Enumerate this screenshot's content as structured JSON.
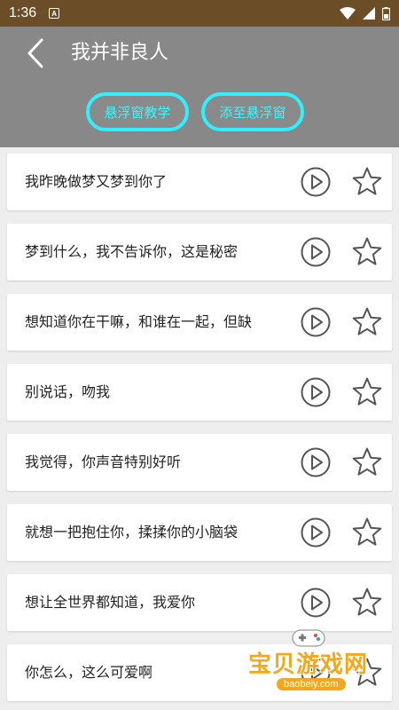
{
  "status_bar": {
    "time": "1:36",
    "notification_letter": "A"
  },
  "header": {
    "title": "我并非良人",
    "buttons": [
      "悬浮窗教学",
      "添至悬浮窗"
    ]
  },
  "colors": {
    "status_bar": "#6b4d28",
    "header_bg": "#888888",
    "pill_accent": "#2ef0ff",
    "watermark": "#f2a81d"
  },
  "items": [
    {
      "text": "我昨晚做梦又梦到你了"
    },
    {
      "text": "梦到什么，我不告诉你，这是秘密"
    },
    {
      "text": "想知道你在干嘛，和谁在一起，但缺"
    },
    {
      "text": "别说话，吻我"
    },
    {
      "text": "我觉得，你声音特别好听"
    },
    {
      "text": "就想一把抱住你，揉揉你的小脑袋"
    },
    {
      "text": "想让全世界都知道，我爱你"
    },
    {
      "text": "你怎么，这么可爱啊"
    }
  ],
  "icons": {
    "back": "chevron-left-icon",
    "play": "play-circle-icon",
    "favorite": "star-outline-icon"
  },
  "watermark": {
    "brand": "宝贝游戏网",
    "url": "baobeiy.com"
  }
}
